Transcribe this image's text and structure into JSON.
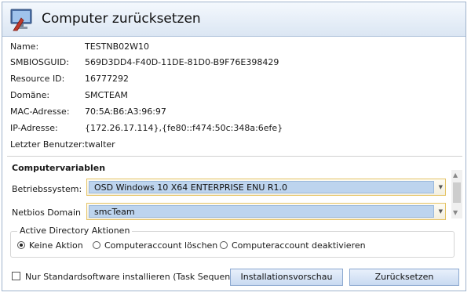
{
  "window": {
    "title": "Computer zurücksetzen",
    "icon": "computer-reset-icon"
  },
  "info": [
    {
      "label": "Name:",
      "value": "TESTNB02W10"
    },
    {
      "label": "SMBIOSGUID:",
      "value": "569D3DD4-F40D-11DE-81D0-B9F76E398429"
    },
    {
      "label": "Resource ID:",
      "value": "16777292"
    },
    {
      "label": "Domäne:",
      "value": "SMCTEAM"
    },
    {
      "label": "MAC-Adresse:",
      "value": "70:5A:B6:A3:96:97"
    },
    {
      "label": "IP-Adresse:",
      "value": "{172.26.17.114},{fe80::f474:50c:348a:6efe}"
    },
    {
      "label": "Letzter Benutzer:",
      "value": "twalter"
    }
  ],
  "variables": {
    "heading": "Computervariablen",
    "os_label": "Betriebssystem:",
    "os_value": "OSD Windows 10 X64 ENTERPRISE ENU R1.0",
    "netbios_label": "Netbios Domain",
    "netbios_value": "smcTeam"
  },
  "ad": {
    "legend": "Active Directory Aktionen",
    "options": [
      "Keine Aktion",
      "Computeraccount löschen",
      "Computeraccount deaktivieren"
    ],
    "selected": "Keine Aktion"
  },
  "footer": {
    "checkbox_label": "Nur Standardsoftware installieren (Task Sequence).",
    "checkbox_checked": false,
    "preview_button": "Installationsvorschau",
    "reset_button": "Zurücksetzen"
  }
}
